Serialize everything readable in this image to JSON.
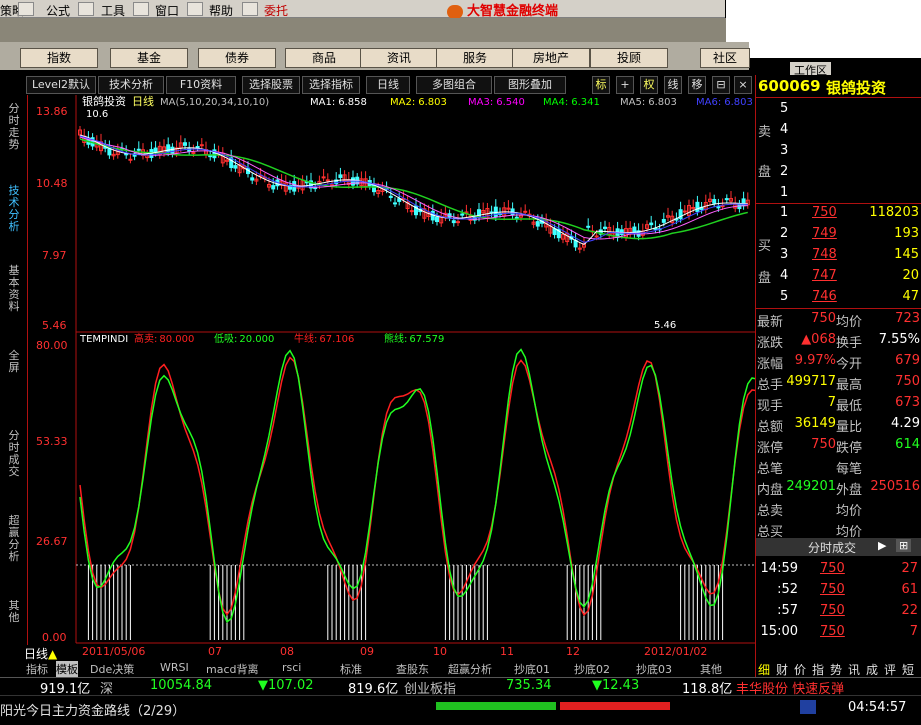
{
  "menu": {
    "items": [
      "策略",
      "公式",
      "工具",
      "窗口",
      "帮助",
      "委托"
    ],
    "logo": "大智慧金融终端"
  },
  "categories": [
    "指数",
    "基金",
    "债券",
    "商品",
    "资讯",
    "服务",
    "房地产",
    "投顾",
    "社区"
  ],
  "toolbar": {
    "level2": "Level2默认",
    "tech": "技术分析",
    "f10": "F10资料",
    "select_stock": "选择股票",
    "select_indicator": "选择指标",
    "period": "日线",
    "multi": "多图组合",
    "overlay": "图形叠加",
    "icons": [
      "标",
      "权",
      "线",
      "移"
    ],
    "workspace": "工作区"
  },
  "stock": {
    "code": "600069",
    "name": "银鸽投资"
  },
  "sidenav": [
    "分时走势",
    "技术分析",
    "基本资料",
    "全屏",
    "分时成交",
    "超赢分析",
    "其他"
  ],
  "price_chart": {
    "title": "银鸽投资",
    "period": "日线",
    "ma_label": "MA(5,10,20,34,10,10)",
    "ma": [
      {
        "name": "MA1:",
        "value": "6.858",
        "color": "#ffffff"
      },
      {
        "name": "MA2:",
        "value": "6.803",
        "color": "#ffff00"
      },
      {
        "name": "MA3:",
        "value": "6.540",
        "color": "#ff00ff"
      },
      {
        "name": "MA4:",
        "value": "6.341",
        "color": "#00ff00"
      },
      {
        "name": "MA5:",
        "value": "6.803",
        "color": "#c0c0c0"
      },
      {
        "name": "MA6:",
        "value": "6.803",
        "color": "#4040ff"
      }
    ],
    "y_ticks": [
      "13.86",
      "10.48",
      "7.97",
      "5.46"
    ],
    "high_label": "10.6",
    "low_label": "5.46"
  },
  "indicator_chart": {
    "name": "TEMPINDI",
    "items": [
      {
        "label": "高卖:",
        "value": "80.000",
        "color": "#ff2020"
      },
      {
        "label": "低吸:",
        "value": "20.000",
        "color": "#20ff20"
      },
      {
        "label": "牛线:",
        "value": "67.106",
        "color": "#ff2020"
      },
      {
        "label": "熊线:",
        "value": "67.579",
        "color": "#20ff20"
      }
    ],
    "y_ticks": [
      "80.00",
      "53.33",
      "26.67",
      "0.00"
    ]
  },
  "x_axis": {
    "labels": [
      "2011/05/06",
      "07",
      "08",
      "09",
      "10",
      "11",
      "12",
      "2012/01/02"
    ],
    "mode": "日线"
  },
  "order_book": {
    "sell_label": [
      "卖",
      "盘"
    ],
    "buy_label": [
      "买",
      "盘"
    ],
    "sell": [
      {
        "level": "5",
        "price": "",
        "vol": ""
      },
      {
        "level": "4",
        "price": "",
        "vol": ""
      },
      {
        "level": "3",
        "price": "",
        "vol": ""
      },
      {
        "level": "2",
        "price": "",
        "vol": ""
      },
      {
        "level": "1",
        "price": "",
        "vol": ""
      }
    ],
    "buy": [
      {
        "level": "1",
        "price": "750",
        "vol": "118203"
      },
      {
        "level": "2",
        "price": "749",
        "vol": "193"
      },
      {
        "level": "3",
        "price": "748",
        "vol": "145"
      },
      {
        "level": "4",
        "price": "747",
        "vol": "20"
      },
      {
        "level": "5",
        "price": "746",
        "vol": "47"
      }
    ]
  },
  "quote": [
    {
      "l1": "最新",
      "v1": "750",
      "c1": "#ff3030",
      "l2": "均价",
      "v2": "723",
      "c2": "#ff3030"
    },
    {
      "l1": "涨跌",
      "v1": "▲068",
      "c1": "#ff3030",
      "l2": "换手",
      "v2": "7.55%",
      "c2": "#ffffff"
    },
    {
      "l1": "涨幅",
      "v1": "9.97%",
      "c1": "#ff3030",
      "l2": "今开",
      "v2": "679",
      "c2": "#ff3030"
    },
    {
      "l1": "总手",
      "v1": "499717",
      "c1": "#ffff00",
      "l2": "最高",
      "v2": "750",
      "c2": "#ff3030"
    },
    {
      "l1": "现手",
      "v1": "7",
      "c1": "#ffff00",
      "l2": "最低",
      "v2": "673",
      "c2": "#ff3030"
    },
    {
      "l1": "总额",
      "v1": "36149",
      "c1": "#ffff00",
      "l2": "量比",
      "v2": "4.29",
      "c2": "#ffffff"
    },
    {
      "l1": "涨停",
      "v1": "750",
      "c1": "#ff3030",
      "l2": "跌停",
      "v2": "614",
      "c2": "#20ff20"
    },
    {
      "l1": "总笔",
      "v1": "",
      "c1": "#ffffff",
      "l2": "每笔",
      "v2": "",
      "c2": "#ffffff"
    },
    {
      "l1": "内盘",
      "v1": "249201",
      "c1": "#20ff20",
      "l2": "外盘",
      "v2": "250516",
      "c2": "#ff3030"
    },
    {
      "l1": "总卖",
      "v1": "",
      "c1": "#ffffff",
      "l2": "均价",
      "v2": "",
      "c2": "#ffffff"
    },
    {
      "l1": "总买",
      "v1": "",
      "c1": "#ffffff",
      "l2": "均价",
      "v2": "",
      "c2": "#ffffff"
    }
  ],
  "trades_header": "分时成交",
  "trades": [
    {
      "time": "14:59",
      "price": "750",
      "vol": "27"
    },
    {
      "time": ":52",
      "price": "750",
      "vol": "61"
    },
    {
      "time": ":57",
      "price": "750",
      "vol": "22"
    },
    {
      "time": "15:00",
      "price": "750",
      "vol": "7"
    }
  ],
  "right_tabs": [
    "细",
    "财",
    "价",
    "指",
    "势",
    "讯",
    "成",
    "评",
    "短"
  ],
  "bottom_tabs": [
    "指标",
    "模板",
    "Dde决策",
    "WRSI",
    "macd背离",
    "rsci",
    "标准",
    "查股东",
    "超赢分析",
    "抄底01",
    "抄底02",
    "抄底03",
    "其他"
  ],
  "status": [
    {
      "text": "919.1亿",
      "color": "#ffffff"
    },
    {
      "text": "深",
      "color": "#c0c0c0"
    },
    {
      "text": "10054.84",
      "color": "#20ff20"
    },
    {
      "text": "▼107.02",
      "color": "#20ff20"
    },
    {
      "text": "819.6亿",
      "color": "#ffffff"
    },
    {
      "text": "创业板指",
      "color": "#c0c0c0"
    },
    {
      "text": "735.34",
      "color": "#20ff20"
    },
    {
      "text": "▼12.43",
      "color": "#20ff20"
    },
    {
      "text": "118.8亿",
      "color": "#ffffff"
    },
    {
      "text": "丰华股份 快速反弹",
      "color": "#ff3030"
    }
  ],
  "ticker": {
    "text": "阳光今日主力资金路线（2/29）",
    "time": "04:54:57"
  }
}
